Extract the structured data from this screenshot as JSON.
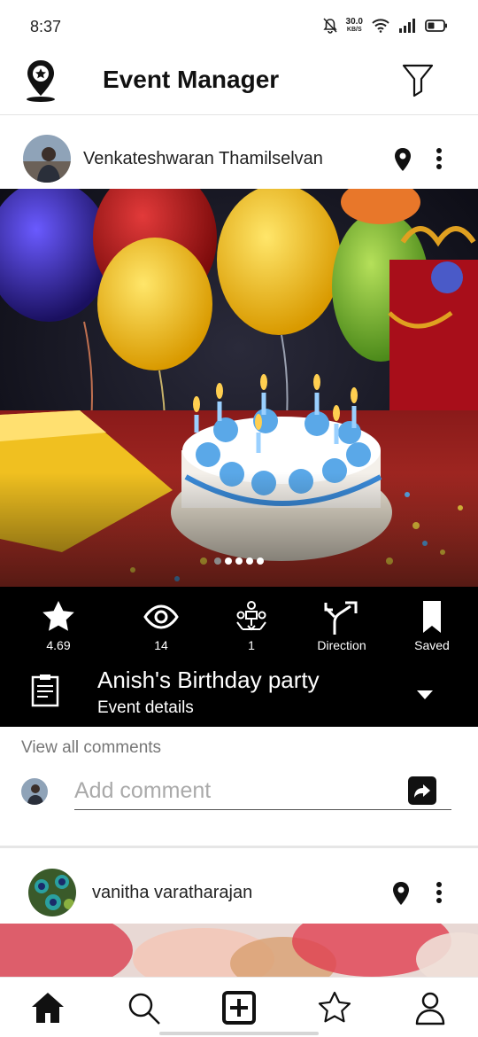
{
  "status_bar": {
    "time": "8:37",
    "net_speed_value": "30.0",
    "net_speed_unit": "KB/S"
  },
  "header": {
    "title": "Event Manager",
    "logo_icon": "location-star-icon",
    "filter_icon": "filter-icon"
  },
  "posts": [
    {
      "author": "Venkateshwaran Thamilselvan",
      "image_subject": "birthday cake with candles and balloons",
      "carousel": {
        "count": 5,
        "active_index": 0
      },
      "actions": {
        "rating": "4.69",
        "views": "14",
        "participants": "1",
        "direction_label": "Direction",
        "saved_label": "Saved"
      },
      "event_title": "Anish's Birthday party",
      "event_subtitle": "Event details",
      "view_comments_label": "View all comments",
      "comment_placeholder": "Add comment"
    },
    {
      "author": "vanitha varatharajan"
    }
  ],
  "bottom_nav": {
    "items": [
      "home-icon",
      "search-icon",
      "add-icon",
      "star-icon",
      "profile-icon"
    ],
    "active": "home-icon"
  },
  "colors": {
    "action_bar_bg": "#000000",
    "text_primary": "#111111",
    "text_muted": "#777777"
  }
}
